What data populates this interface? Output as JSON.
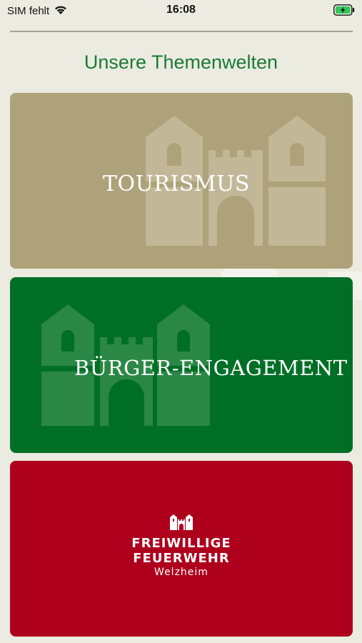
{
  "status_bar": {
    "carrier": "SIM fehlt",
    "time": "16:08",
    "icons": [
      "wifi-icon",
      "battery-charging-icon"
    ]
  },
  "header": {
    "title": "Unsere Themenwelten"
  },
  "cards": [
    {
      "label": "TOURISMUS",
      "color": "#aea27a",
      "icon": "castle-icon"
    },
    {
      "label": "BÜRGER-ENGAGEMENT",
      "color": "#006f26",
      "icon": "castle-icon"
    },
    {
      "logo_line1": "FREIWILLIGE",
      "logo_line2": "FEUERWEHR",
      "logo_sub": "Welzheim",
      "color": "#ae001c",
      "icon": "castle-icon"
    }
  ],
  "colors": {
    "background": "#ecebe1",
    "title_green": "#1a7a35",
    "battery_green": "#34c759"
  }
}
